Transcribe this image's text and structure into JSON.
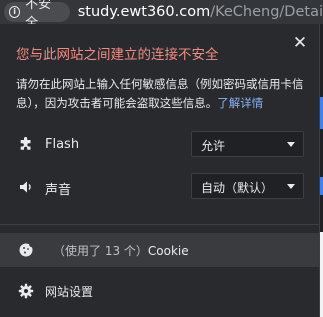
{
  "addressbar": {
    "security_chip": "不安全",
    "url_host": "study.ewt360.com",
    "url_path": "/KeCheng/Detai"
  },
  "popup": {
    "title": "您与此网站之间建立的连接不安全",
    "description": "请勿在此网站上输入任何敏感信息（例如密码或信用卡信息），因为攻击者可能会盗取这些信息。",
    "learn_more": "了解详情",
    "close_glyph": "✕",
    "permissions": [
      {
        "icon": "puzzle-icon",
        "label": "Flash",
        "value": "允许"
      },
      {
        "icon": "speaker-icon",
        "label": "声音",
        "value": "自动（默认）"
      }
    ],
    "cookies": {
      "count_text": "（使用了 13 个）",
      "label": "Cookie"
    },
    "site_settings": "网站设置"
  },
  "colors": {
    "warning": "#f28b82",
    "link": "#8ab4f8",
    "popup_bg": "#292a2d",
    "highlight_row": "#3a3b3e"
  }
}
